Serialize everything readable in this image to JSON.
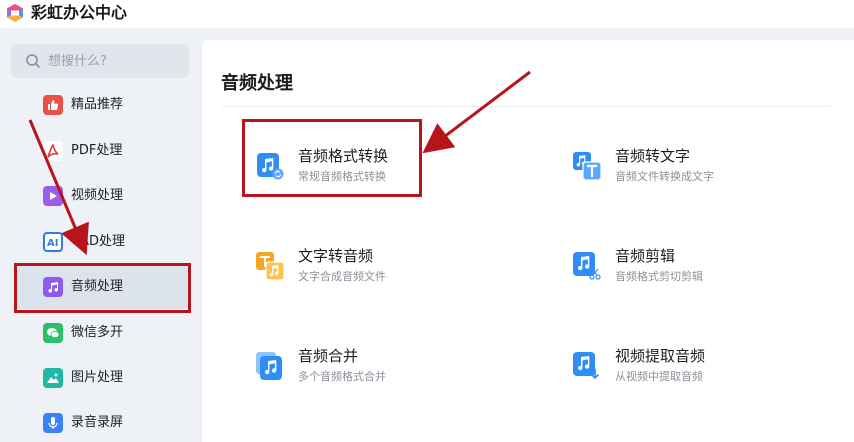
{
  "app": {
    "title": "彩虹办公中心",
    "logo_icon": "rainbow-logo-icon"
  },
  "search": {
    "placeholder": "想搜什么?"
  },
  "sidebar": {
    "items": [
      {
        "label": "精品推荐",
        "icon": "thumbs-up-icon",
        "color": "#e8504a"
      },
      {
        "label": "PDF处理",
        "icon": "pdf-icon",
        "color": "#e23b3b"
      },
      {
        "label": "视频处理",
        "icon": "video-play-icon",
        "color": "#9b5cf0"
      },
      {
        "label": "CAD处理",
        "icon": "cad-icon",
        "color": "#2f7de1"
      },
      {
        "label": "音频处理",
        "icon": "music-note-icon",
        "color": "#8a5cf0",
        "active": true
      },
      {
        "label": "微信多开",
        "icon": "wechat-icon",
        "color": "#2bbf6a"
      },
      {
        "label": "图片处理",
        "icon": "image-icon",
        "color": "#1fb8a6"
      },
      {
        "label": "录音录屏",
        "icon": "microphone-icon",
        "color": "#3b82f6"
      }
    ]
  },
  "main": {
    "title": "音频处理",
    "tools": [
      {
        "name": "音频格式转换",
        "desc": "常规音频格式转换",
        "icon": "audio-convert-icon",
        "highlighted": true
      },
      {
        "name": "音频转文字",
        "desc": "音频文件转换成文字",
        "icon": "audio-to-text-icon"
      },
      {
        "name": "文字转音频",
        "desc": "文字合成音频文件",
        "icon": "text-to-audio-icon"
      },
      {
        "name": "音频剪辑",
        "desc": "音频格式剪切剪辑",
        "icon": "audio-cut-icon"
      },
      {
        "name": "音频合并",
        "desc": "多个音频格式合并",
        "icon": "audio-merge-icon"
      },
      {
        "name": "视频提取音频",
        "desc": "从视频中提取音频",
        "icon": "video-extract-audio-icon"
      }
    ]
  },
  "colors": {
    "accent_blue": "#2f8ef5",
    "accent_orange": "#f5a623",
    "annotation_red": "#b5151b"
  }
}
